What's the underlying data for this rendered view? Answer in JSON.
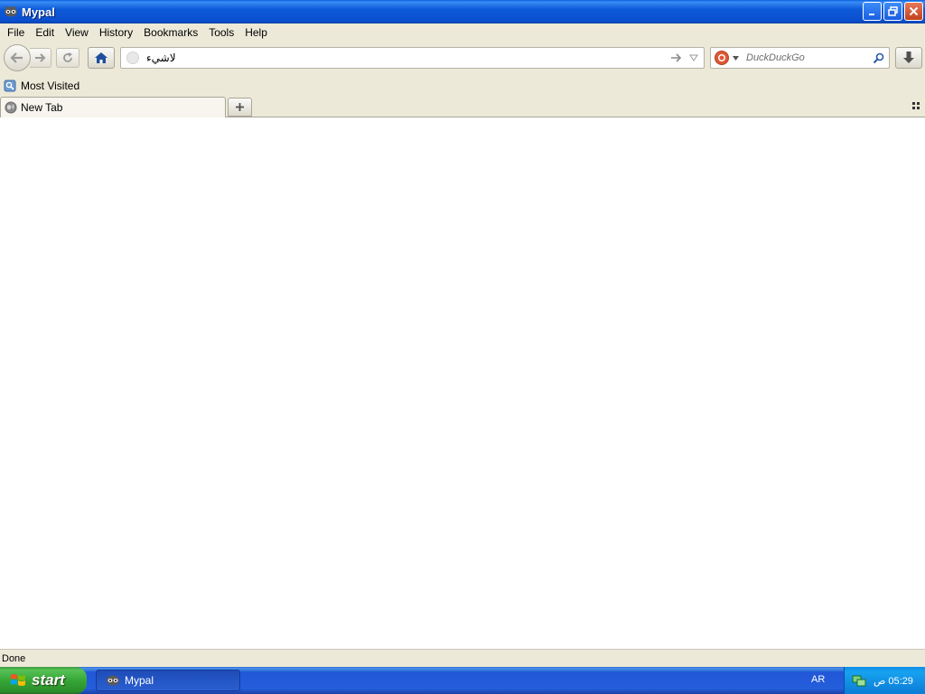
{
  "window": {
    "title": "Mypal",
    "icon": "mypal-raccoon-icon"
  },
  "window_buttons": {
    "minimize": "minimize-icon",
    "restore": "restore-icon",
    "close": "close-icon"
  },
  "menu": [
    "File",
    "Edit",
    "View",
    "History",
    "Bookmarks",
    "Tools",
    "Help"
  ],
  "navbar": {
    "url_value": "لاشيء",
    "search_placeholder": "DuckDuckGo",
    "search_engine_icon": "duckduckgo-icon"
  },
  "bookmarks": {
    "item_label": "Most Visited"
  },
  "tabs": [
    {
      "label": "New Tab"
    }
  ],
  "status": {
    "text": "Done"
  },
  "taskbar": {
    "start_label": "start",
    "task_label": "Mypal",
    "language": "AR",
    "clock": "05:29 ص"
  },
  "colors": {
    "titlebar_blue": "#0a4fcf",
    "chrome_beige": "#ece9d8",
    "start_green": "#36a636",
    "tray_blue": "#0c7fd8"
  }
}
